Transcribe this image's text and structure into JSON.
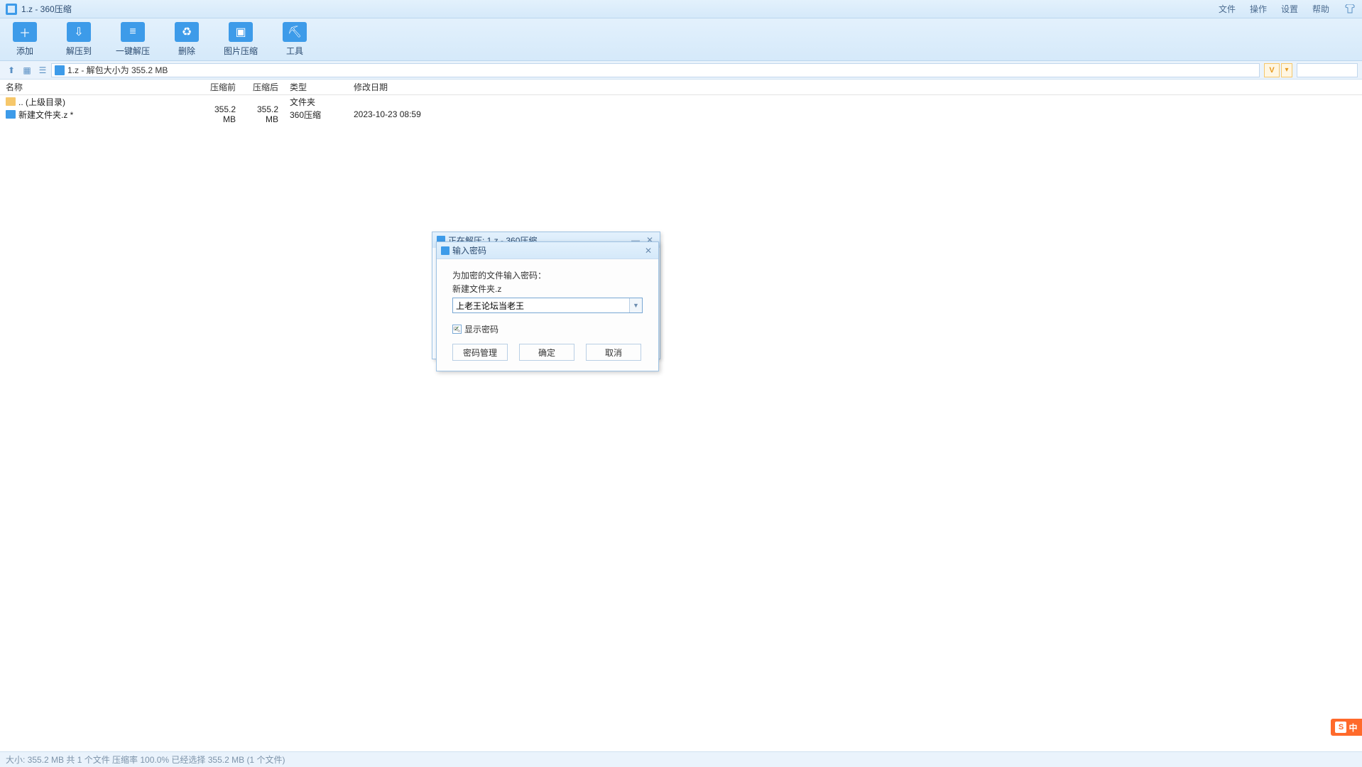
{
  "titlebar": {
    "title": "1.z - 360压缩",
    "menus": {
      "file": "文件",
      "operation": "操作",
      "settings": "设置",
      "help": "帮助"
    }
  },
  "toolbar": {
    "add": "添加",
    "extract_to": "解压到",
    "one_click": "一键解压",
    "delete": "删除",
    "image_compress": "图片压缩",
    "tools": "工具"
  },
  "addressbar": {
    "path": "1.z - 解包大小为 355.2 MB",
    "v_label": "V"
  },
  "columns": {
    "name": "名称",
    "before": "压缩前",
    "after": "压缩后",
    "type": "类型",
    "date": "修改日期"
  },
  "rows": {
    "parent": {
      "name": ".. (上级目录)",
      "type": "文件夹"
    },
    "item1": {
      "name": "新建文件夹.z *",
      "before": "355.2 MB",
      "after": "355.2 MB",
      "type": "360压缩",
      "date": "2023-10-23 08:59"
    }
  },
  "status": {
    "text": "大小: 355.2 MB 共 1 个文件 压缩率 100.0% 已经选择 355.2 MB (1 个文件)"
  },
  "bg_dialog": {
    "title": "正在解压: 1.z - 360压缩"
  },
  "pw_dialog": {
    "title": "输入密码",
    "prompt": "为加密的文件输入密码：",
    "filename": "新建文件夹.z",
    "value": "上老王论坛当老王",
    "show_pw": "显示密码",
    "manage": "密码管理",
    "ok": "确定",
    "cancel": "取消"
  },
  "ime": {
    "char": "S",
    "label": "中"
  }
}
